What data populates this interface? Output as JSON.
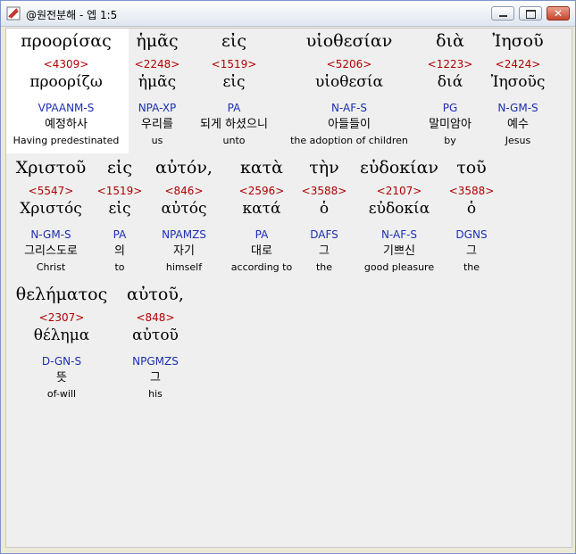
{
  "window": {
    "title": "@원전분해 - 엡 1:5"
  },
  "words": [
    {
      "greek": "προορίσας",
      "strong": "<4309>",
      "lemma": "προορίζω",
      "parse": "VPAANM-S",
      "korean": "예정하사",
      "english": "Having predestinated"
    },
    {
      "greek": "ἡμᾶς",
      "strong": "<2248>",
      "lemma": "ἡμᾶς",
      "parse": "NPA-XP",
      "korean": "우리를",
      "english": "us"
    },
    {
      "greek": "εἰς",
      "strong": "<1519>",
      "lemma": "εἰς",
      "parse": "PA",
      "korean": "되게 하셨으니",
      "english": "unto"
    },
    {
      "greek": "υἱοθεσίαν",
      "strong": "<5206>",
      "lemma": "υἱοθεσία",
      "parse": "N-AF-S",
      "korean": "아들들이",
      "english": "the adoption of children"
    },
    {
      "greek": "διὰ",
      "strong": "<1223>",
      "lemma": "διά",
      "parse": "PG",
      "korean": "말미암아",
      "english": "by"
    },
    {
      "greek": "Ἰησοῦ",
      "strong": "<2424>",
      "lemma": "Ἰησοῦς",
      "parse": "N-GM-S",
      "korean": "예수",
      "english": "Jesus"
    },
    {
      "greek": "Χριστοῦ",
      "strong": "<5547>",
      "lemma": "Χριστός",
      "parse": "N-GM-S",
      "korean": "그리스도로",
      "english": "Christ"
    },
    {
      "greek": "εἰς",
      "strong": "<1519>",
      "lemma": "εἰς",
      "parse": "PA",
      "korean": "의",
      "english": "to"
    },
    {
      "greek": "αὐτόν,",
      "strong": "<846>",
      "lemma": "αὐτός",
      "parse": "NPAMZS",
      "korean": "자기",
      "english": "himself"
    },
    {
      "greek": "κατὰ",
      "strong": "<2596>",
      "lemma": "κατά",
      "parse": "PA",
      "korean": "대로",
      "english": "according to"
    },
    {
      "greek": "τὴν",
      "strong": "<3588>",
      "lemma": "ὁ",
      "parse": "DAFS",
      "korean": "그",
      "english": "the"
    },
    {
      "greek": "εὐδοκίαν",
      "strong": "<2107>",
      "lemma": "εὐδοκία",
      "parse": "N-AF-S",
      "korean": "기쁘신",
      "english": "good pleasure"
    },
    {
      "greek": "τοῦ",
      "strong": "<3588>",
      "lemma": "ὁ",
      "parse": "DGNS",
      "korean": "그",
      "english": "the"
    },
    {
      "greek": "θελήματος",
      "strong": "<2307>",
      "lemma": "θέλημα",
      "parse": "D-GN-S",
      "korean": "뜻",
      "english": "of-will"
    },
    {
      "greek": "αὐτοῦ,",
      "strong": "<848>",
      "lemma": "αὐτοῦ",
      "parse": "NPGMZS",
      "korean": "그",
      "english": "his"
    }
  ]
}
